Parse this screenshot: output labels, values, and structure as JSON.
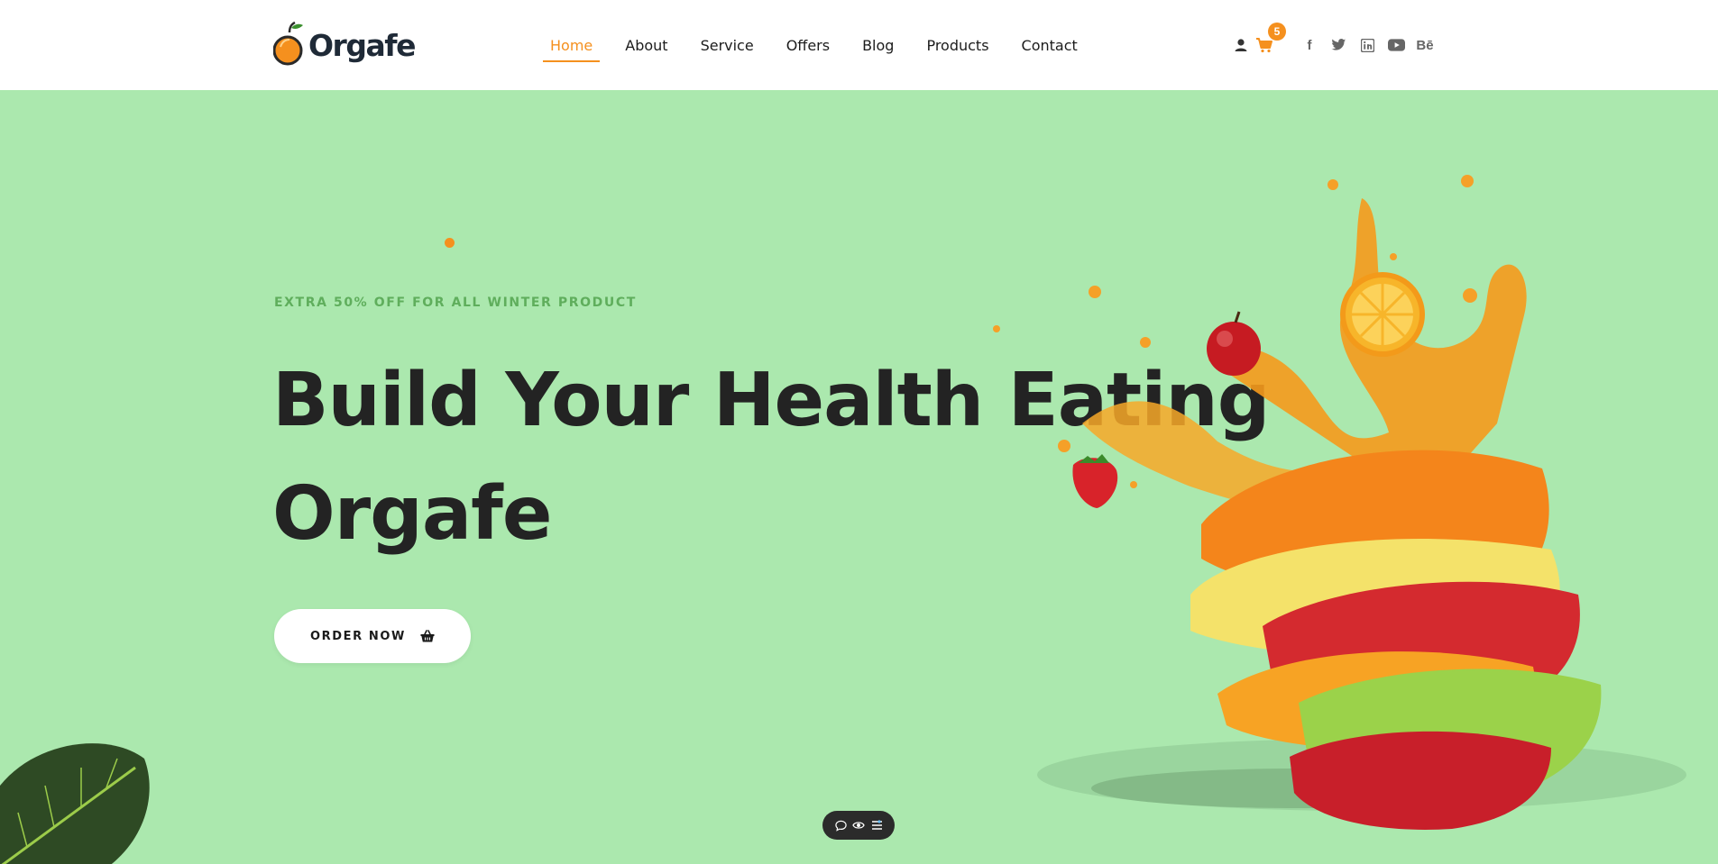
{
  "brand": {
    "name": "Orgafe",
    "accent_color": "#f5901e",
    "hero_bg": "#abe8ae"
  },
  "nav": {
    "items": [
      {
        "label": "Home",
        "active": true
      },
      {
        "label": "About"
      },
      {
        "label": "Service"
      },
      {
        "label": "Offers"
      },
      {
        "label": "Blog"
      },
      {
        "label": "Products"
      },
      {
        "label": "Contact"
      }
    ]
  },
  "tools": {
    "icons": [
      "user-icon",
      "cart-icon"
    ],
    "cart_count": "5",
    "socials": [
      {
        "icon": "facebook-icon",
        "glyph": "f"
      },
      {
        "icon": "twitter-icon"
      },
      {
        "icon": "linkedin-icon"
      },
      {
        "icon": "youtube-icon"
      },
      {
        "icon": "behance-icon",
        "glyph": "Bē"
      }
    ]
  },
  "hero": {
    "eyebrow": "EXTRA 50% OFF FOR ALL WINTER PRODUCT",
    "title_line1": "Build Your Health Eating",
    "title_line2": "Orgafe",
    "cta_label": "ORDER NOW",
    "cta_icon": "basket-icon"
  },
  "floating_toolbar": {
    "icons": [
      "chat-icon",
      "eye-icon",
      "list-icon"
    ]
  }
}
